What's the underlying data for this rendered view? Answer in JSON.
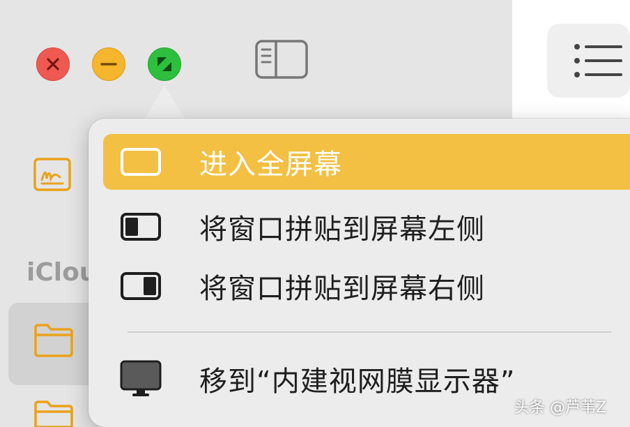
{
  "window": {
    "buttons": [
      {
        "name": "close",
        "color": "#ee5a52"
      },
      {
        "name": "minimize",
        "color": "#f5b52c"
      },
      {
        "name": "zoom",
        "color": "#2dbf3e"
      }
    ],
    "toolbar_icons": [
      "sidebar-toggle-icon",
      "list-view-icon"
    ]
  },
  "sidebar": {
    "section_label": "iClou",
    "items": [
      {
        "icon": "notes-signature-icon"
      },
      {
        "icon": "folder-icon",
        "selected": true
      },
      {
        "icon": "folder-icon",
        "selected": false
      }
    ]
  },
  "menu": {
    "items": [
      {
        "label": "进入全屏幕",
        "icon": "fullscreen-icon",
        "highlighted": true
      },
      {
        "label": "将窗口拼贴到屏幕左侧",
        "icon": "tile-left-icon",
        "highlighted": false
      },
      {
        "label": "将窗口拼贴到屏幕右侧",
        "icon": "tile-right-icon",
        "highlighted": false
      },
      {
        "label": "移到“内建视网膜显示器”",
        "icon": "display-icon",
        "highlighted": false
      }
    ],
    "highlight_color": "#f3c044"
  },
  "watermark": "头条 @芦苇Z"
}
